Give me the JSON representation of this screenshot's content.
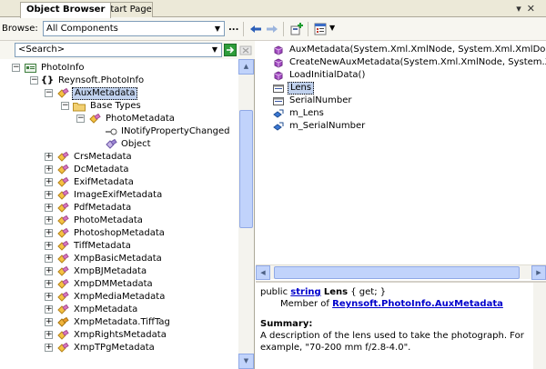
{
  "tabs": [
    {
      "label": "Object Browser",
      "active": true
    },
    {
      "label": "Start Page",
      "active": false
    }
  ],
  "tab_buttons": {
    "dropdown": "▾",
    "close": "✕"
  },
  "toolbar": {
    "browse_label": "Browse:",
    "browse_value": "All Components",
    "more_label": "...",
    "icons": [
      "back-arrow-icon",
      "forward-arrow-icon",
      "add-reference-icon",
      "settings-icon"
    ]
  },
  "search": {
    "placeholder": "<Search>"
  },
  "tree": [
    {
      "label": "PhotoInfo",
      "icon": "assembly-icon",
      "expander": "−"
    },
    {
      "label": "Reynsoft.PhotoInfo",
      "icon": "namespace-icon",
      "expander": "−"
    },
    {
      "label": "AuxMetadata",
      "icon": "class-icon",
      "expander": "−",
      "selected": true
    },
    {
      "label": "Base Types",
      "icon": "folder-icon",
      "expander": "−"
    },
    {
      "label": "PhotoMetadata",
      "icon": "class-icon",
      "expander": "−"
    },
    {
      "label": "INotifyPropertyChanged",
      "icon": "interface-icon",
      "expander": ""
    },
    {
      "label": "Object",
      "icon": "class-icon",
      "expander": ""
    },
    {
      "label": "CrsMetadata",
      "icon": "class-icon",
      "expander": "+"
    },
    {
      "label": "DcMetadata",
      "icon": "class-icon",
      "expander": "+"
    },
    {
      "label": "ExifMetadata",
      "icon": "class-icon",
      "expander": "+"
    },
    {
      "label": "ImageExifMetadata",
      "icon": "class-icon",
      "expander": "+"
    },
    {
      "label": "PdfMetadata",
      "icon": "class-icon",
      "expander": "+"
    },
    {
      "label": "PhotoMetadata",
      "icon": "class-icon",
      "expander": "+"
    },
    {
      "label": "PhotoshopMetadata",
      "icon": "class-icon",
      "expander": "+"
    },
    {
      "label": "TiffMetadata",
      "icon": "class-icon",
      "expander": "+"
    },
    {
      "label": "XmpBasicMetadata",
      "icon": "class-icon",
      "expander": "+"
    },
    {
      "label": "XmpBJMetadata",
      "icon": "class-icon",
      "expander": "+"
    },
    {
      "label": "XmpDMMetadata",
      "icon": "class-icon",
      "expander": "+"
    },
    {
      "label": "XmpMediaMetadata",
      "icon": "class-icon",
      "expander": "+"
    },
    {
      "label": "XmpMetadata",
      "icon": "class-icon",
      "expander": "+"
    },
    {
      "label": "XmpMetadata.TiffTag",
      "icon": "enum-icon",
      "expander": "+"
    },
    {
      "label": "XmpRightsMetadata",
      "icon": "class-icon",
      "expander": "+"
    },
    {
      "label": "XmpTPgMetadata",
      "icon": "class-icon",
      "expander": "+"
    }
  ],
  "members": [
    {
      "label": "AuxMetadata(System.Xml.XmlNode, System.Xml.XmlDocument)",
      "icon": "method-icon"
    },
    {
      "label": "CreateNewAuxMetadata(System.Xml.XmlNode, System.Xml.XmlD",
      "icon": "method-icon"
    },
    {
      "label": "LoadInitialData()",
      "icon": "method-icon"
    },
    {
      "label": "Lens",
      "icon": "property-icon",
      "selected": true
    },
    {
      "label": "SerialNumber",
      "icon": "property-icon"
    },
    {
      "label": "m_Lens",
      "icon": "field-icon"
    },
    {
      "label": "m_SerialNumber",
      "icon": "field-icon"
    }
  ],
  "description": {
    "sig_public": "public",
    "sig_type": "string",
    "sig_name": "Lens",
    "sig_accessors": "{ get; }",
    "member_of_label": "Member of",
    "member_of_link": "Reynsoft.PhotoInfo.AuxMetadata",
    "summary_label": "Summary:",
    "summary_text": "A description of the lens used to take the photograph. For example, \"70-200 mm f/2.8-4.0\"."
  }
}
